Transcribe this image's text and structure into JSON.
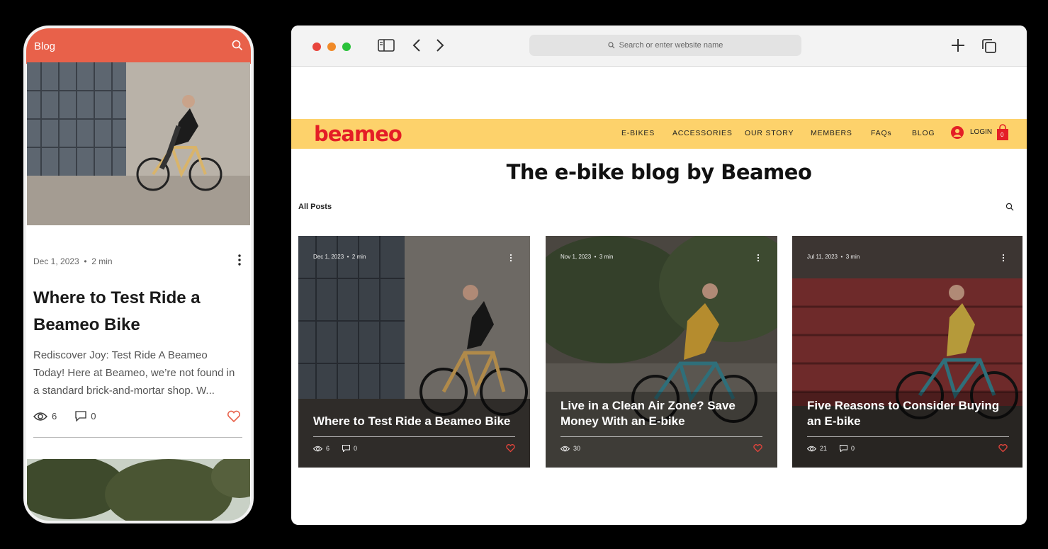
{
  "mobile": {
    "header_title": "Blog",
    "post": {
      "date": "Dec 1, 2023",
      "separator": "•",
      "read_time": "2 min",
      "title": "Where to Test Ride a Beameo Bike",
      "excerpt": "Rediscover Joy: Test Ride A Beameo Today! Here at Beameo, we’re not found in a standard brick-and-mortar shop. W...",
      "views": "6",
      "comments": "0"
    },
    "accent_color": "#e8614a"
  },
  "browser": {
    "url_placeholder": "Search or enter website name"
  },
  "site": {
    "logo": "beameo",
    "brand_color": "#e41e26",
    "nav_color": "#fdd26b",
    "nav": [
      "E-BIKES",
      "ACCESSORIES",
      "OUR STORY",
      "MEMBERS",
      "FAQs",
      "BLOG"
    ],
    "login": "LOGIN",
    "cart_count": "0",
    "blog_title": "The e-bike blog by Beameo",
    "filter": "All Posts"
  },
  "posts": [
    {
      "date": "Dec 1, 2023",
      "read_time": "2 min",
      "title": "Where to Test Ride a Beameo Bike",
      "views": "6",
      "comments": "0"
    },
    {
      "date": "Nov 1, 2023",
      "read_time": "3 min",
      "title": "Live in a Clean Air Zone? Save Money With an E-bike",
      "views": "30",
      "comments": ""
    },
    {
      "date": "Jul 11, 2023",
      "read_time": "3 min",
      "title": "Five Reasons to Consider Buying an E-bike",
      "views": "21",
      "comments": "0"
    }
  ]
}
